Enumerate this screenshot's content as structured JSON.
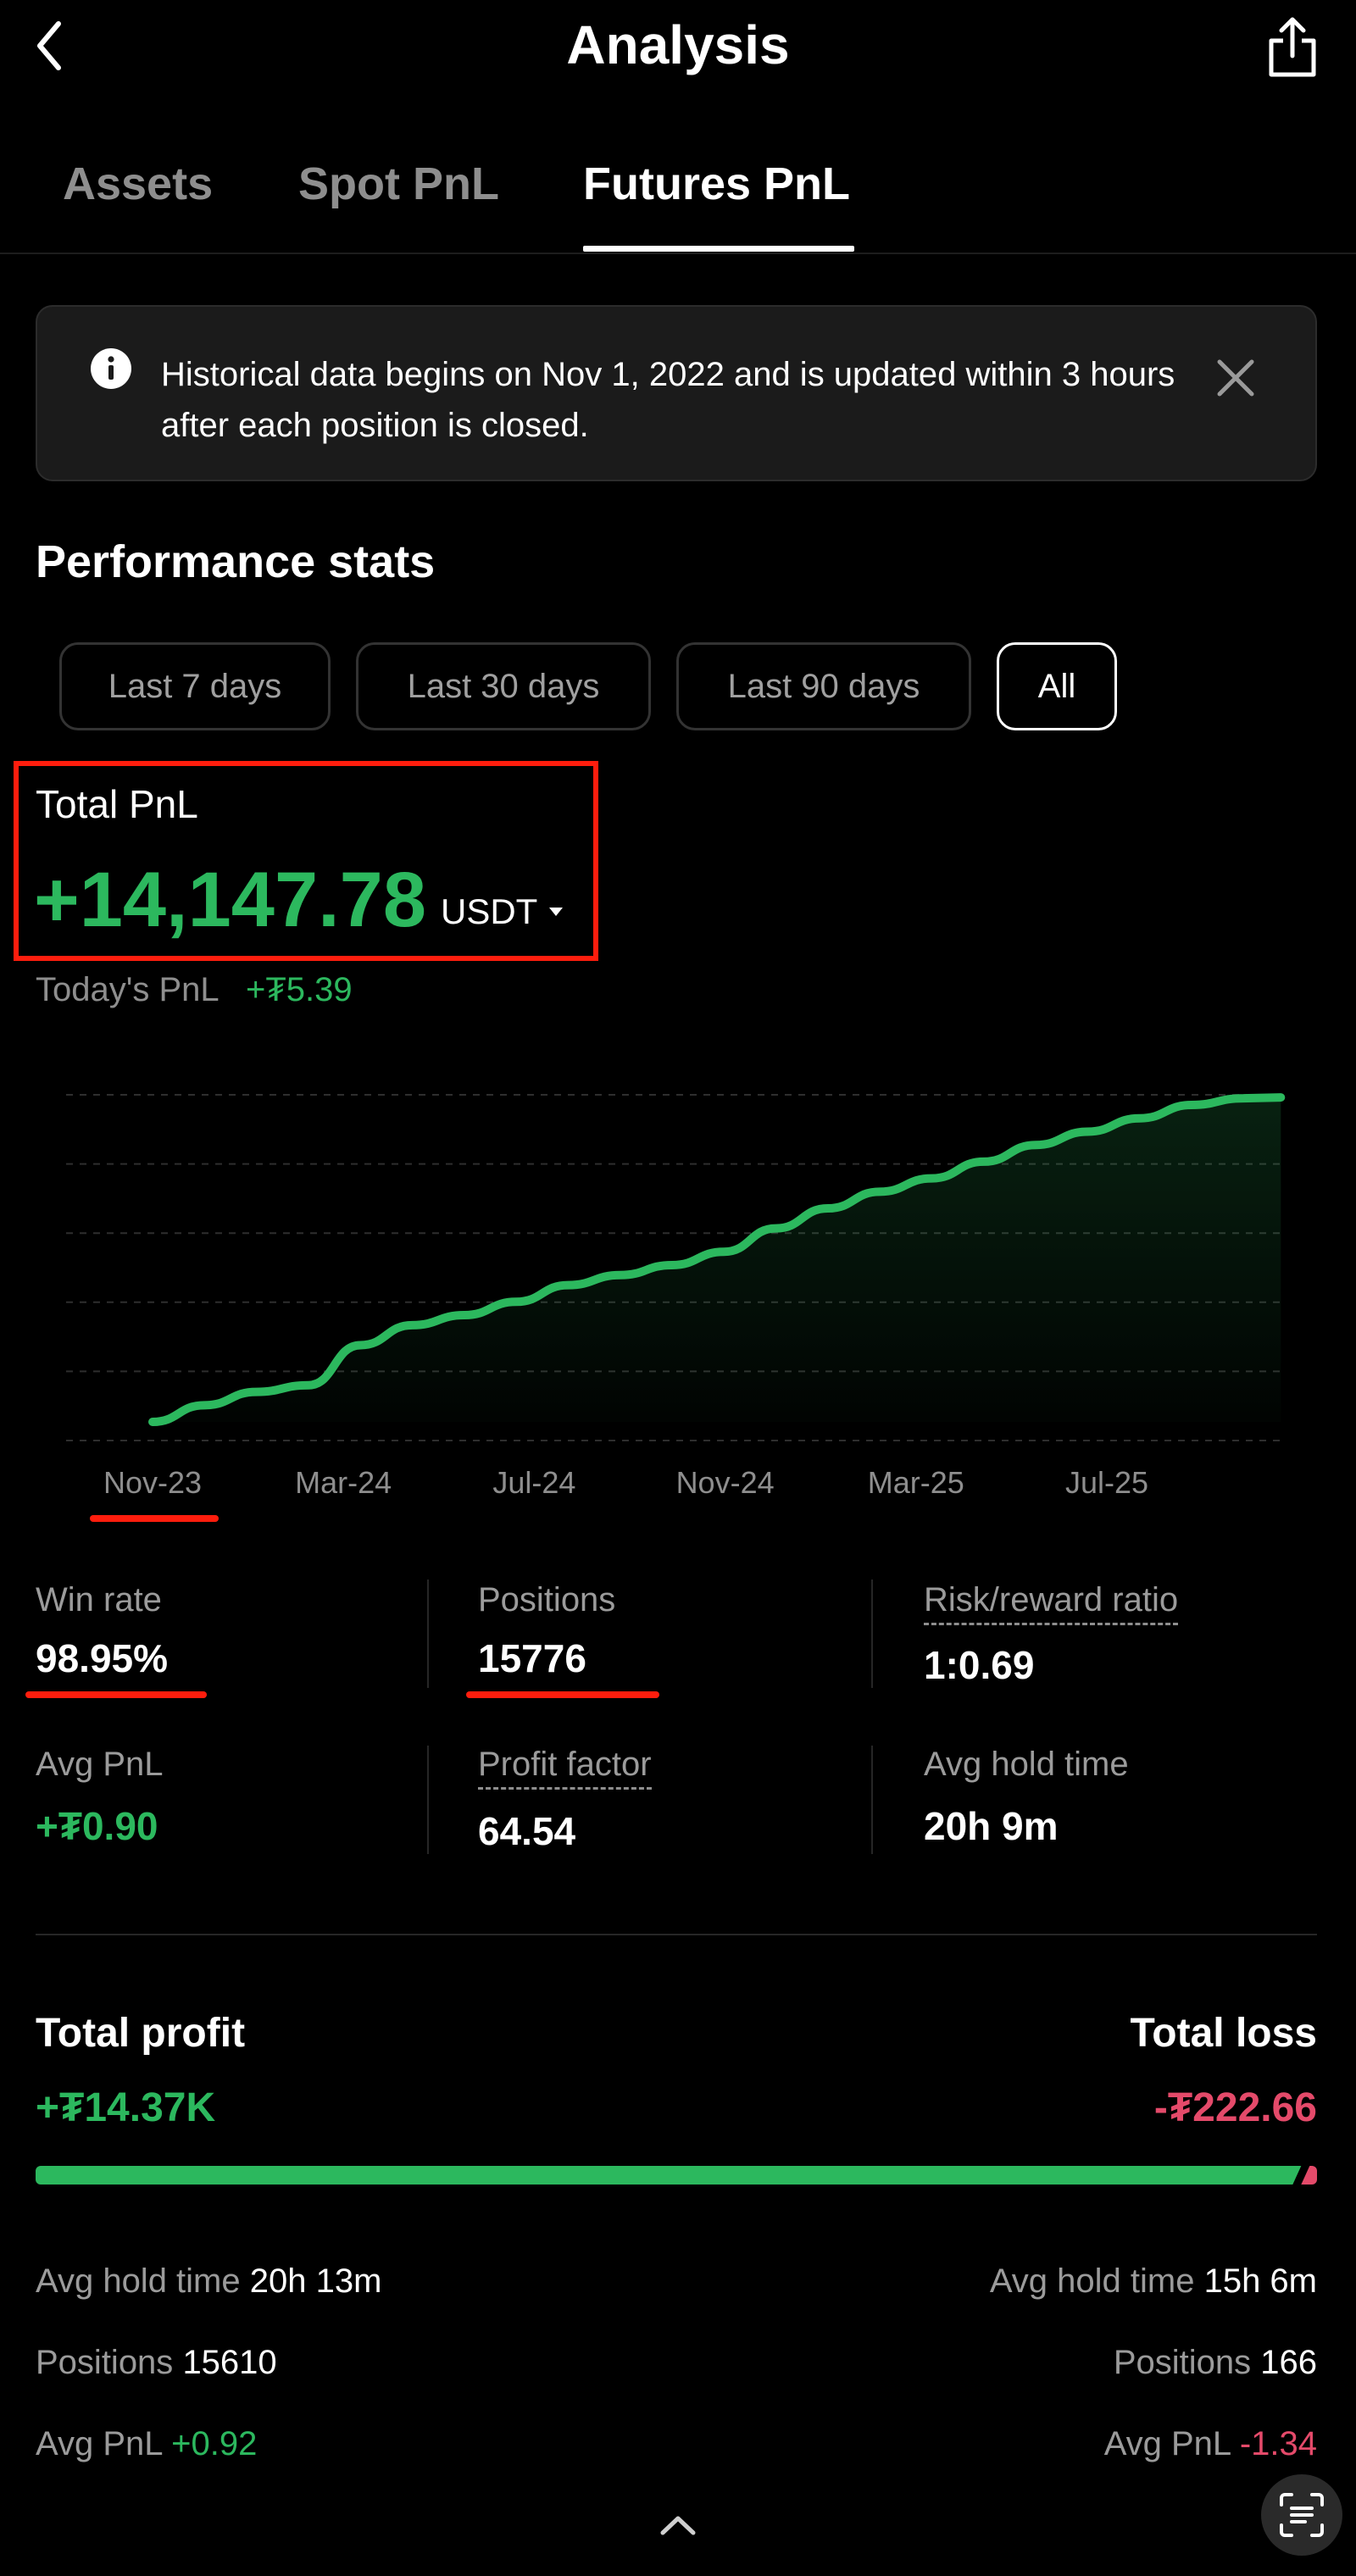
{
  "header": {
    "title": "Analysis"
  },
  "tabs": [
    {
      "label": "Assets"
    },
    {
      "label": "Spot PnL"
    },
    {
      "label": "Futures PnL"
    }
  ],
  "notice": {
    "text": "Historical data begins on Nov 1, 2022 and is updated within 3 hours after each position is closed."
  },
  "performance": {
    "title": "Performance stats",
    "periods": [
      "Last 7 days",
      "Last 30 days",
      "Last 90 days",
      "All"
    ],
    "selected_period": "All"
  },
  "total_pnl": {
    "label": "Total PnL",
    "value": "+14,147.78",
    "unit": "USDT",
    "today_label": "Today's PnL",
    "today_value": "+₮5.39"
  },
  "chart_data": {
    "type": "area",
    "x_tick_labels": [
      "Nov-23",
      "Mar-24",
      "Jul-24",
      "Nov-24",
      "Mar-25",
      "Jul-25"
    ],
    "x_tick_positions": [
      0,
      4,
      8,
      12,
      16,
      20
    ],
    "x": [
      0,
      1,
      2,
      3,
      4,
      5,
      6,
      7,
      8,
      9,
      10,
      11,
      12,
      13,
      14,
      15,
      16,
      17,
      18,
      19,
      20,
      21
    ],
    "values": [
      0.0,
      0.05,
      0.09,
      0.11,
      0.23,
      0.29,
      0.32,
      0.36,
      0.41,
      0.44,
      0.47,
      0.51,
      0.58,
      0.64,
      0.69,
      0.73,
      0.78,
      0.83,
      0.87,
      0.91,
      0.95,
      0.97
    ],
    "y_axis": "hidden",
    "grid": "horizontal dashed",
    "line_color": "#2cb85e"
  },
  "stats": {
    "win_rate": {
      "label": "Win rate",
      "value": "98.95%"
    },
    "positions": {
      "label": "Positions",
      "value": "15776"
    },
    "risk_reward": {
      "label": "Risk/reward ratio",
      "value": "1:0.69"
    },
    "avg_pnl": {
      "label": "Avg PnL",
      "value": "+₮0.90"
    },
    "profit_factor": {
      "label": "Profit factor",
      "value": "64.54"
    },
    "avg_hold_time": {
      "label": "Avg hold time",
      "value": "20h 9m"
    }
  },
  "profit_loss": {
    "profit_label": "Total profit",
    "loss_label": "Total loss",
    "profit_value": "+₮14.37K",
    "loss_value": "-₮222.66",
    "profit_share": 0.985,
    "profit": {
      "avg_hold_label": "Avg hold time",
      "avg_hold_value": "20h 13m",
      "positions_label": "Positions",
      "positions_value": "15610",
      "avg_pnl_label": "Avg PnL",
      "avg_pnl_value": "+0.92"
    },
    "loss": {
      "avg_hold_label": "Avg hold time",
      "avg_hold_value": "15h 6m",
      "positions_label": "Positions",
      "positions_value": "166",
      "avg_pnl_label": "Avg PnL",
      "avg_pnl_value": "-1.34"
    }
  },
  "colors": {
    "green": "#2cb85e",
    "red": "#e44a6a",
    "highlight": "#ff1d0d"
  },
  "icons": [
    "back-chevron-icon",
    "share-icon",
    "info-icon",
    "close-icon",
    "caret-down-icon",
    "chevron-up-icon",
    "scan-text-icon"
  ]
}
